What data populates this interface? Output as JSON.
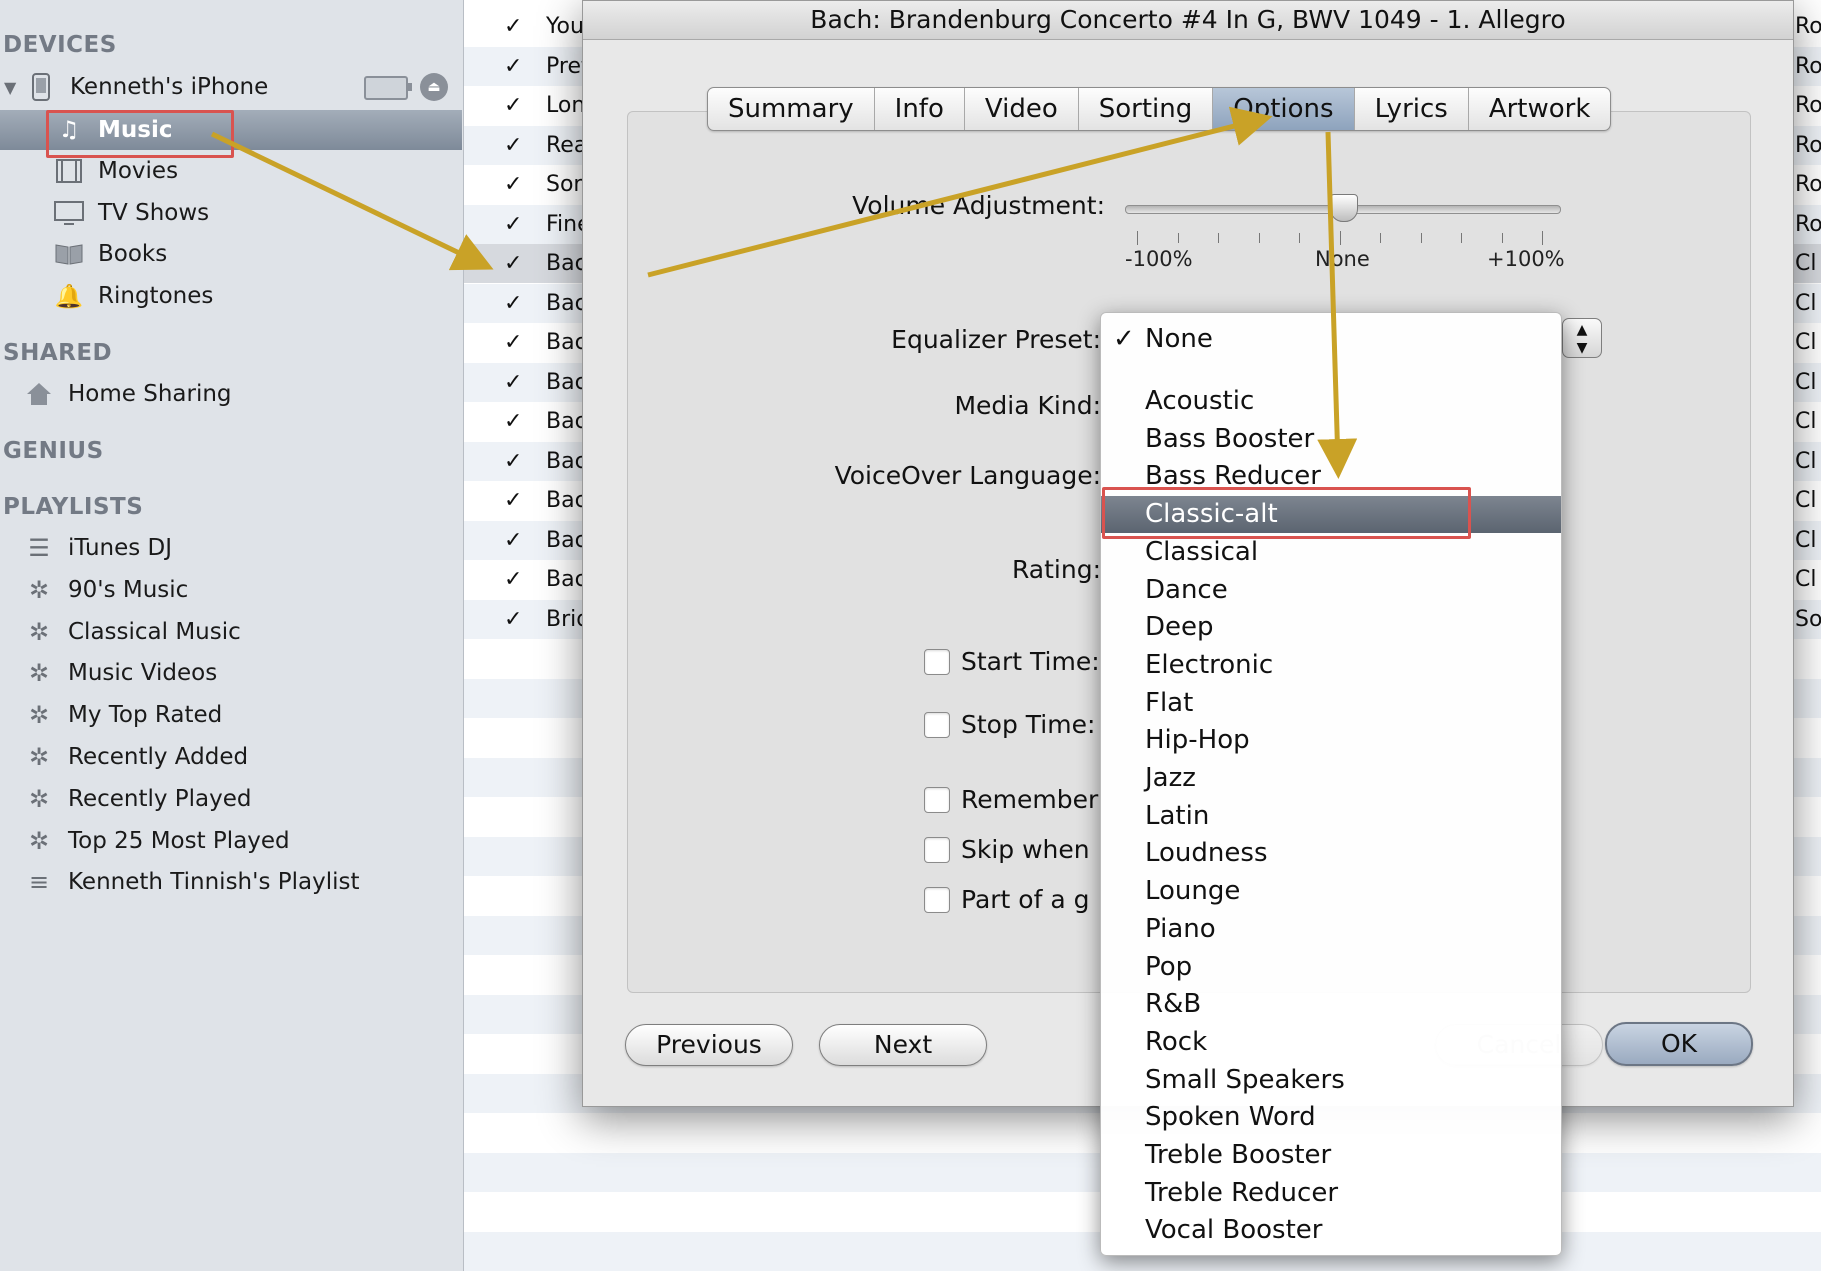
{
  "sidebar": {
    "devices_header": "DEVICES",
    "device_name": "Kenneth's iPhone",
    "device_items": [
      "Music",
      "Movies",
      "TV Shows",
      "Books",
      "Ringtones"
    ],
    "shared_header": "SHARED",
    "shared_items": [
      "Home Sharing"
    ],
    "genius_header": "GENIUS",
    "playlists_header": "PLAYLISTS",
    "playlists": [
      "iTunes DJ",
      "90's Music",
      "Classical Music",
      "Music Videos",
      "My Top Rated",
      "Recently Added",
      "Recently Played",
      "Top 25 Most Played",
      "Kenneth Tinnish's Playlist"
    ]
  },
  "songs": {
    "check": "✓",
    "titles": [
      "You",
      "Pret",
      "Lon",
      "Rea",
      "Son",
      "Fine",
      "Bach",
      "Bach",
      "Bach",
      "Bach",
      "Bach",
      "Bach",
      "Bach",
      "Bach",
      "Bach",
      "Brid"
    ],
    "right_col": [
      "Ro",
      "Ro",
      "Ro",
      "Ro",
      "Ro",
      "Ro",
      "Cl",
      "Cl",
      "Cl",
      "Cl",
      "Cl",
      "Cl",
      "Cl",
      "Cl",
      "Cl",
      "So"
    ]
  },
  "dialog": {
    "title": "Bach: Brandenburg Concerto #4 In G, BWV 1049 - 1. Allegro",
    "tabs": [
      "Summary",
      "Info",
      "Video",
      "Sorting",
      "Options",
      "Lyrics",
      "Artwork"
    ],
    "active_tab": "Options",
    "volume_label": "Volume Adjustment:",
    "volume_value": 0,
    "slider_min": "-100%",
    "slider_mid": "None",
    "slider_max": "+100%",
    "eq_label": "Equalizer Preset:",
    "media_kind_label": "Media Kind:",
    "voiceover_label": "VoiceOver Language:",
    "rating_label": "Rating:",
    "start_time_label": "Start Time:",
    "stop_time_label": "Stop Time:",
    "remember_label": "Remember",
    "skip_label": "Skip when",
    "gapless_label": "Part of a g",
    "previous_btn": "Previous",
    "next_btn": "Next",
    "cancel_btn": "Cancel",
    "ok_btn": "OK"
  },
  "eq_menu": {
    "selected": "None",
    "checkmark": "✓",
    "highlighted": "Classic-alt",
    "items": [
      "Acoustic",
      "Bass Booster",
      "Bass Reducer",
      "Classic-alt",
      "Classical",
      "Dance",
      "Deep",
      "Electronic",
      "Flat",
      "Hip-Hop",
      "Jazz",
      "Latin",
      "Loudness",
      "Lounge",
      "Piano",
      "Pop",
      "R&B",
      "Rock",
      "Small Speakers",
      "Spoken Word",
      "Treble Booster",
      "Treble Reducer",
      "Vocal Booster"
    ]
  },
  "colors": {
    "annotation_arrow": "#c9a227",
    "annotation_box": "#d9534f"
  }
}
